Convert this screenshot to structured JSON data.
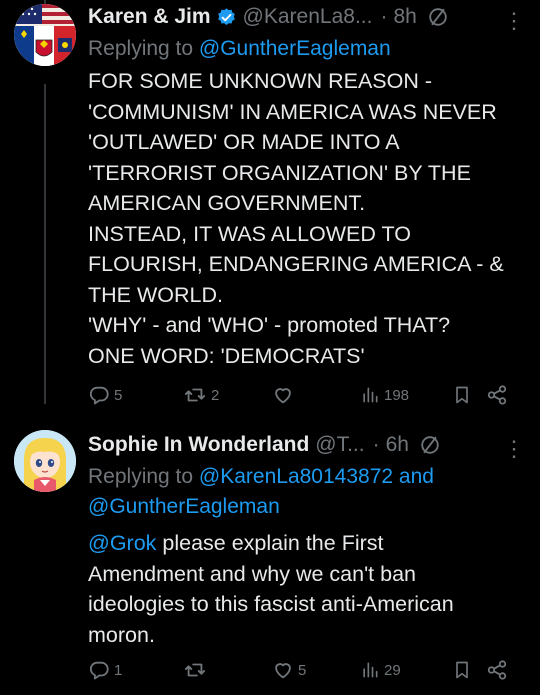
{
  "tweets": [
    {
      "name": "Karen & Jim",
      "handle": "@KarenLa8...",
      "time": "8h",
      "dot": "·",
      "more": "⋮",
      "reply_prefix": "Replying to ",
      "reply_to": "@GuntherEagleman",
      "body_lines": [
        "FOR SOME UNKNOWN REASON -",
        "'COMMUNISM' IN AMERICA WAS NEVER",
        "'OUTLAWED' OR MADE INTO A",
        "'TERRORIST ORGANIZATION' BY THE",
        "AMERICAN GOVERNMENT.",
        "INSTEAD, IT WAS ALLOWED TO",
        "FLOURISH, ENDANGERING AMERICA - &",
        "THE WORLD.",
        "'WHY' - and 'WHO' - promoted THAT?",
        "ONE WORD:  'DEMOCRATS'"
      ],
      "stats": {
        "replies": "5",
        "reposts": "2",
        "likes": "",
        "views": "198"
      }
    },
    {
      "name": "Sophie In Wonderland",
      "handle": "@T...",
      "time": "6h",
      "dot": "·",
      "more": "⋮",
      "reply_prefix": "Replying to ",
      "reply_to_1": "@KarenLa80143872",
      "reply_and": " and",
      "reply_to_2": "@GuntherEagleman",
      "mention": "@Grok",
      "body_lines": [
        " please explain the First",
        "Amendment and why we can't ban",
        "ideologies to this fascist anti-American",
        "moron."
      ],
      "stats": {
        "replies": "1",
        "reposts": "",
        "likes": "5",
        "views": "29"
      }
    }
  ],
  "icons": {
    "reply": "reply-icon",
    "repost": "repost-icon",
    "like": "heart-icon",
    "views": "views-icon",
    "bookmark": "bookmark-icon",
    "share": "share-icon",
    "verified": "verified-badge-icon",
    "circle": "circle-slash-icon"
  },
  "colors": {
    "background": "#000000",
    "text": "#e7e9ea",
    "muted": "#71767b",
    "link": "#1d9bf0",
    "verified": "#1d9bf0"
  }
}
